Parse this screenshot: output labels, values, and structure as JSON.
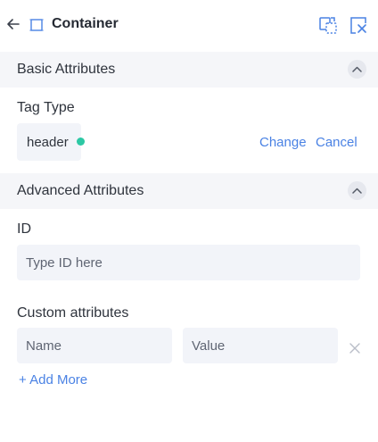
{
  "header": {
    "title": "Container",
    "icons": [
      "back-arrow-icon",
      "container-icon",
      "select-parent-icon",
      "remove-element-icon"
    ]
  },
  "basic_section": {
    "title": "Basic Attributes",
    "tag_type_label": "Tag Type",
    "tag_value": "header",
    "change_link": "Change",
    "cancel_link": "Cancel"
  },
  "advanced_section": {
    "title": "Advanced Attributes",
    "id_label": "ID",
    "id_placeholder": "Type ID here",
    "custom_label": "Custom attributes",
    "name_placeholder": "Name",
    "value_placeholder": "Value",
    "add_more": "+ Add More"
  },
  "colors": {
    "accent": "#4a82e4",
    "success": "#2cc8a4",
    "section_bg": "#f5f6f9",
    "input_bg": "#f2f4f9"
  }
}
